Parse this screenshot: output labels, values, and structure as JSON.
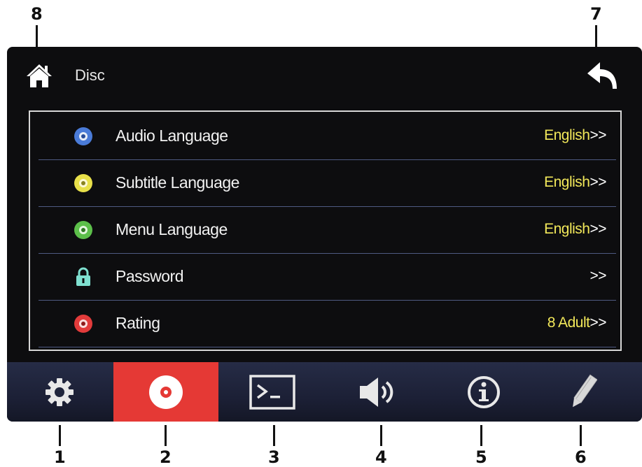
{
  "header": {
    "title": "Disc"
  },
  "settings": [
    {
      "label": "Audio Language",
      "value": "English",
      "suffix": ">>",
      "icon": "disc-icon",
      "color": "#4a7bd8"
    },
    {
      "label": "Subtitle Language",
      "value": "English",
      "suffix": ">>",
      "icon": "disc-icon",
      "color": "#e8e04a"
    },
    {
      "label": "Menu Language",
      "value": "English",
      "suffix": ">>",
      "icon": "disc-icon",
      "color": "#5cbf4a"
    },
    {
      "label": "Password",
      "value": "",
      "suffix": ">>",
      "icon": "lock-icon",
      "color": "#7fe0d0"
    },
    {
      "label": "Rating",
      "value": "8 Adult",
      "suffix": ">>",
      "icon": "disc-icon",
      "color": "#e23b3b"
    }
  ],
  "tabs": [
    {
      "name": "settings",
      "icon": "gear-icon",
      "active": false
    },
    {
      "name": "disc",
      "icon": "disc-icon",
      "active": true
    },
    {
      "name": "terminal",
      "icon": "terminal-icon",
      "active": false
    },
    {
      "name": "audio",
      "icon": "speaker-icon",
      "active": false
    },
    {
      "name": "info",
      "icon": "info-icon",
      "active": false
    },
    {
      "name": "edit",
      "icon": "pencil-icon",
      "active": false
    }
  ],
  "callouts": [
    "1",
    "2",
    "3",
    "4",
    "5",
    "6",
    "7",
    "8"
  ],
  "colors": {
    "accent": "#e53935",
    "value_text": "#f2e85a",
    "row_divider": "#4f5a82"
  }
}
